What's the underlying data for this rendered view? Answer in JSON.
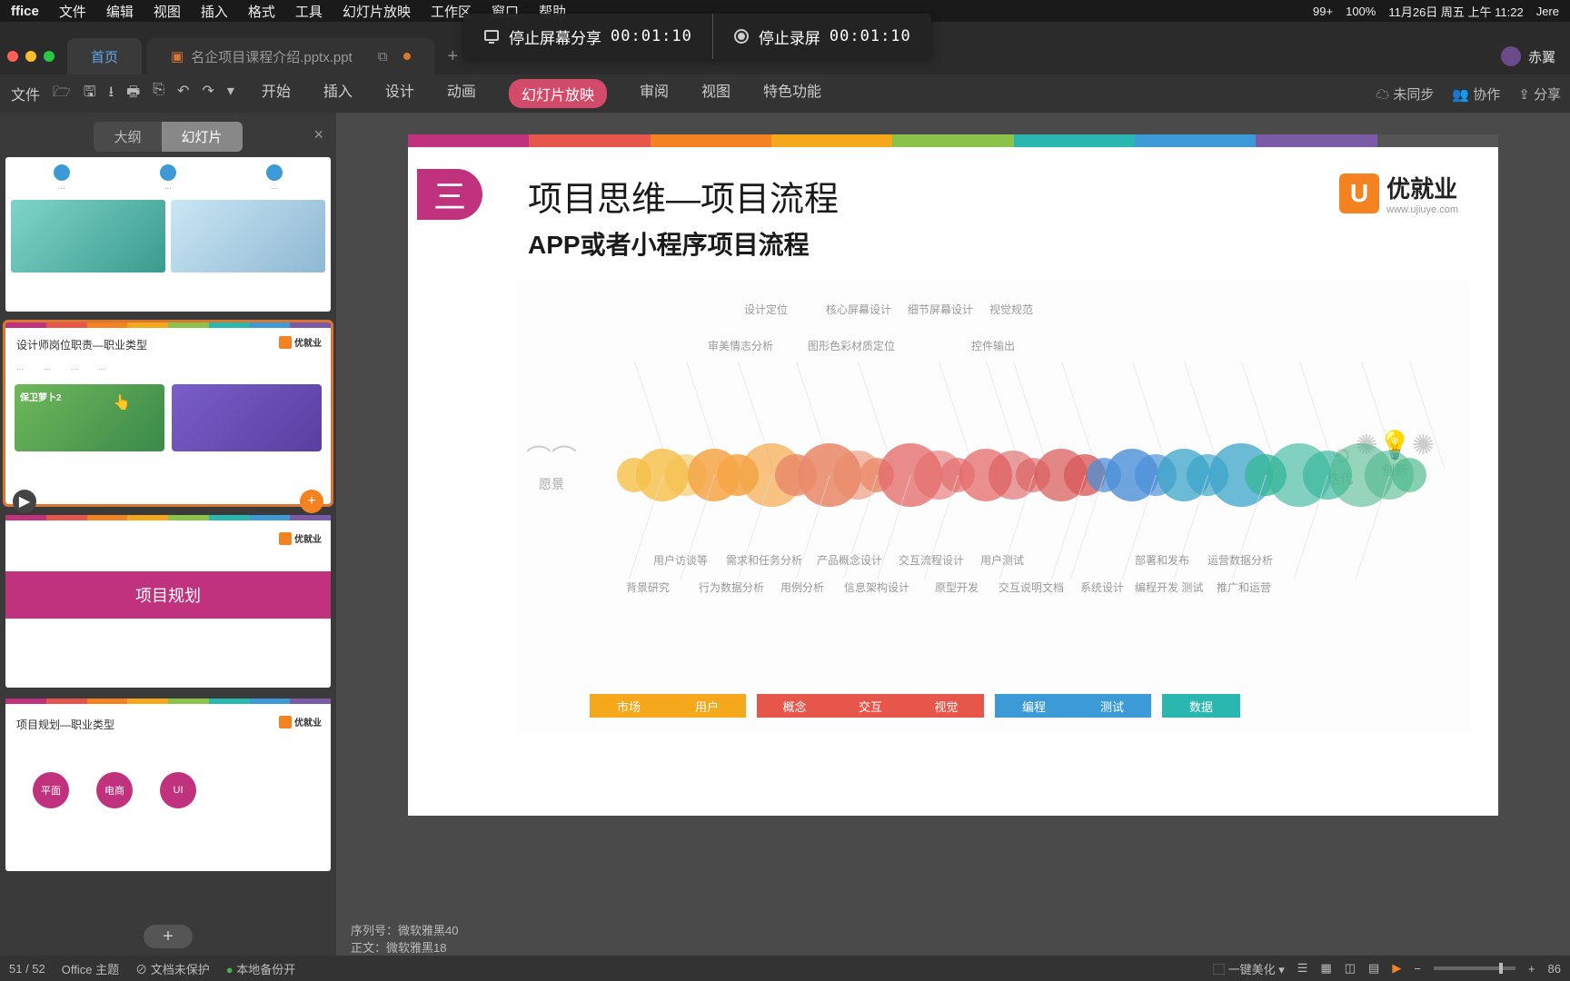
{
  "menubar": {
    "items": [
      "ffice",
      "文件",
      "编辑",
      "视图",
      "插入",
      "格式",
      "工具",
      "幻灯片放映",
      "工作区",
      "窗口",
      "帮助"
    ],
    "right": {
      "count": "99+",
      "zoom": "100%",
      "date": "11月26日 周五 上午 11:22",
      "user": "Jere"
    }
  },
  "share": {
    "stop_share": "停止屏幕分享",
    "t1": "00:01:10",
    "stop_rec": "停止录屏",
    "t2": "00:01:10"
  },
  "tabs": {
    "home": "首页",
    "file": "名企项目课程介绍.pptx.ppt",
    "user": "赤翼"
  },
  "ribbon": {
    "tabs": [
      "开始",
      "插入",
      "设计",
      "动画",
      "幻灯片放映",
      "审阅",
      "视图",
      "特色功能"
    ],
    "unsync": "未同步",
    "collab": "协作",
    "share": "分享"
  },
  "views": {
    "outline": "大纲",
    "slides": "幻灯片"
  },
  "thumbs": {
    "t2": {
      "title": "设计师岗位职责—职业类型"
    },
    "t3": {
      "title": "项目规划"
    },
    "t4": {
      "title": "项目规划—职业类型",
      "pills": [
        "平面",
        "电商",
        "UI"
      ]
    }
  },
  "slide": {
    "title": "项目思维—项目流程",
    "subtitle": "APP或者小程序项目流程",
    "logo": {
      "brand": "优就业",
      "url": "www.ujiuye.com"
    },
    "anchors": {
      "vision": "愿景",
      "iterate": "迭代",
      "innovate": "创新"
    },
    "labels_top": [
      "设计定位",
      "核心屏幕设计",
      "细节屏幕设计",
      "视觉规范"
    ],
    "labels_mid": [
      "审美情志分析",
      "图形色彩材质定位",
      "控件输出"
    ],
    "labels_bottom_upper": [
      "用户访谈等",
      "需求和任务分析",
      "产品概念设计",
      "交互流程设计",
      "用户测试",
      "部署和发布",
      "运营数据分析"
    ],
    "labels_bottom_lower": [
      "背景研究",
      "行为数据分析",
      "用例分析",
      "信息架构设计",
      "原型开发",
      "交互说明文档",
      "系统设计",
      "编程开发 测试",
      "推广和运营"
    ],
    "legend": [
      "市场",
      "用户",
      "概念",
      "交互",
      "视觉",
      "编程",
      "测试",
      "数据"
    ]
  },
  "info": {
    "seq": "序列号：微软雅黑40",
    "body": "正文：微软雅黑18"
  },
  "status": {
    "page": "51 / 52",
    "theme": "Office 主题",
    "protect": "文档未保护",
    "backup": "本地备份开",
    "beautify": "一键美化",
    "zoom": "86"
  },
  "colors": {
    "strip": [
      "#c0317e",
      "#e6564a",
      "#f58220",
      "#f6a81c",
      "#8bc34a",
      "#2ab7b0",
      "#3c9bd6",
      "#7b5aa6",
      "#555"
    ],
    "legend": [
      "#f6a81c",
      "#f6a81c",
      "#e6564a",
      "#e6564a",
      "#e6564a",
      "#3c9bd6",
      "#3c9bd6",
      "#2ab7b0"
    ],
    "blob_groups": [
      "#f5c04a",
      "#f5a545",
      "#e98a6a",
      "#e46a6a",
      "#d95a5a",
      "#4a8ed6",
      "#3aa3c9",
      "#3ab79c",
      "#4ab78a"
    ]
  }
}
